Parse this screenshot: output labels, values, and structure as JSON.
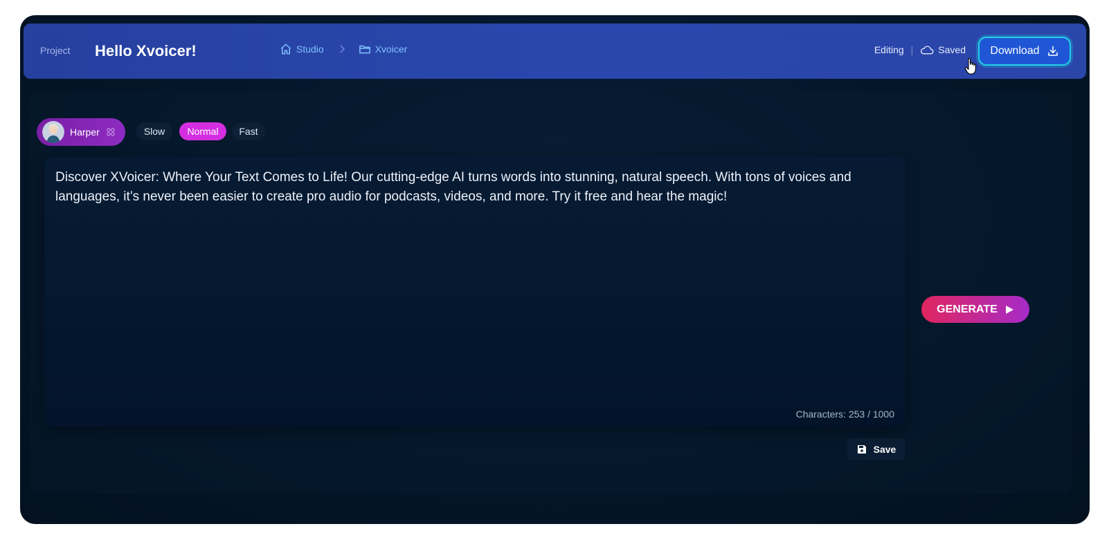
{
  "header": {
    "project_label": "Project",
    "project_title": "Hello Xvoicer!",
    "breadcrumb": [
      {
        "label": "Studio",
        "icon": "home-icon"
      },
      {
        "label": "Xvoicer",
        "icon": "folder-icon"
      }
    ],
    "status_editing": "Editing",
    "status_divider": "|",
    "status_saved": "Saved",
    "download_label": "Download"
  },
  "voice": {
    "name": "Harper",
    "speeds": [
      "Slow",
      "Normal",
      "Fast"
    ],
    "selected_speed": "Normal"
  },
  "editor": {
    "text": "Discover XVoicer: Where Your Text Comes to Life! Our cutting-edge AI turns words into stunning, natural speech. With tons of voices and languages, it’s never been easier to create pro audio for podcasts, videos, and more. Try it free and hear the magic!",
    "char_count": "Characters: 253 / 1000"
  },
  "actions": {
    "generate_label": "GENERATE",
    "save_label": "Save"
  },
  "colors": {
    "header_blue": "#2947ad",
    "accent_cyan": "#21d2e6",
    "accent_magenta": "#d52ee2",
    "generate_start": "#e0265f",
    "generate_end": "#a52bc8",
    "background": "#04162a"
  }
}
